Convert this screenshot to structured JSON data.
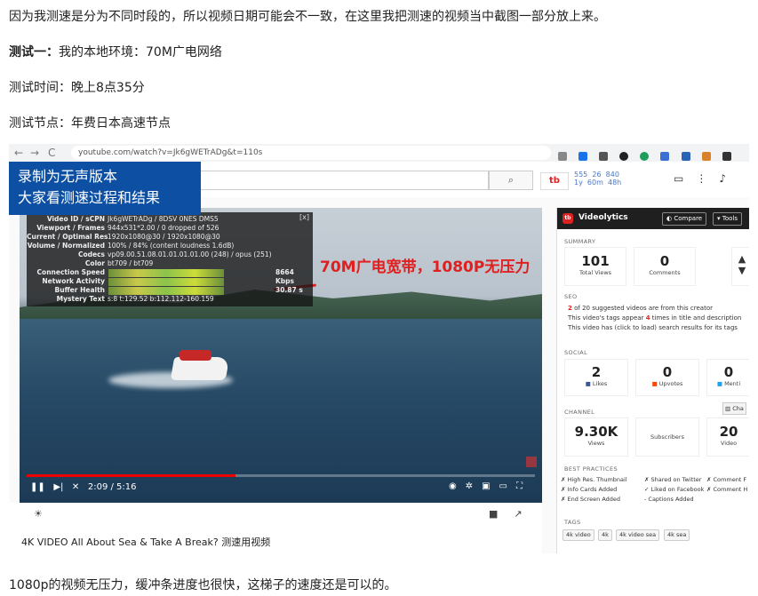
{
  "article": {
    "intro": "因为我测速是分为不同时段的，所以视频日期可能会不一致，在这里我把测速的视频当中截图一部分放上来。",
    "test_label": "测试一：",
    "test_env": "我的本地环境：70M广电网络",
    "test_time": "测试时间：晚上8点35分",
    "test_node": "测试节点：年费日本高速节点",
    "conclusion": "1080p的视频无压力，缓冲条进度也很快，这梯子的速度还是可以的。"
  },
  "browser": {
    "back": "←",
    "forward": "→",
    "reload": "C",
    "url": "youtube.com/watch?v=Jk6gWETrADg&t=110s"
  },
  "tubebuddy": {
    "logo": "tb",
    "stats": [
      "555",
      "26",
      "840",
      "1y",
      "60m",
      "48h"
    ]
  },
  "banner": {
    "line1": "录制为无声版本",
    "line2": "大家看测速过程和结果"
  },
  "stats_overlay": {
    "close": "[x]",
    "rows": [
      {
        "label": "Video ID / sCPN",
        "value": "Jk6gWETrADg / 8DSV 0NES DMS5"
      },
      {
        "label": "Viewport / Frames",
        "value": "944x531*2.00 / 0 dropped of 526"
      },
      {
        "label": "Current / Optimal Res",
        "value": "1920x1080@30 / 1920x1080@30"
      },
      {
        "label": "Volume / Normalized",
        "value": "100% / 84% (content loudness 1.6dB)"
      },
      {
        "label": "Codecs",
        "value": "vp09.00.51.08.01.01.01.01.00 (248) / opus (251)"
      },
      {
        "label": "Color",
        "value": "bt709 / bt709"
      },
      {
        "label": "Connection Speed",
        "value": ""
      },
      {
        "label": "Network Activity",
        "value": ""
      },
      {
        "label": "Buffer Health",
        "value": ""
      },
      {
        "label": "Mystery Text",
        "value": "s:8 t:129.52 b:112.112-160.159"
      }
    ],
    "connection_speed": "8664 Kbps",
    "buffer_health": "30.87 s"
  },
  "video": {
    "annotation": "70M广电宽带，1080P无压力",
    "time": "2:09 / 5:16",
    "progress": 0.41,
    "title": "4K VIDEO All About Sea & Take A Break? 测速用视频"
  },
  "videolytics": {
    "name": "Videolytics",
    "compare": "Compare",
    "tools": "Tools",
    "summary_label": "SUMMARY",
    "total_views": "101",
    "total_views_label": "Total Views",
    "comments": "0",
    "comments_label": "Comments",
    "seo_label": "SEO",
    "seo_line1_num": "2",
    "seo_line1_text": "of 20 suggested videos are from this creator",
    "seo_line2_pre": "This video's tags appear",
    "seo_line2_num": "4",
    "seo_line2_post": "times in title and description",
    "seo_line3": "This video has (click to load) search results for its tags",
    "social_label": "SOCIAL",
    "likes": "2",
    "likes_label": "Likes",
    "upvotes": "0",
    "upvotes_label": "Upvotes",
    "mentions": "0",
    "mentions_label": "Menti",
    "channel_label": "CHANNEL",
    "channel_chat": "Cha",
    "views": "9.30K",
    "views_label": "Views",
    "subscribers_label": "Subscribers",
    "videos": "20",
    "videos_label": "Video",
    "bp_label": "BEST PRACTICES",
    "bp": [
      "✗ High Res. Thumbnail",
      "✗ Shared on Twitter",
      "✗ Comment F",
      "✗ Info Cards Added",
      "✓ Liked on Facebook",
      "✗ Comment H",
      "✗ End Screen Added",
      "- Captions Added"
    ],
    "tags_label": "TAGS",
    "tags": [
      "4k video",
      "4k",
      "4k video sea",
      "4k sea"
    ]
  }
}
